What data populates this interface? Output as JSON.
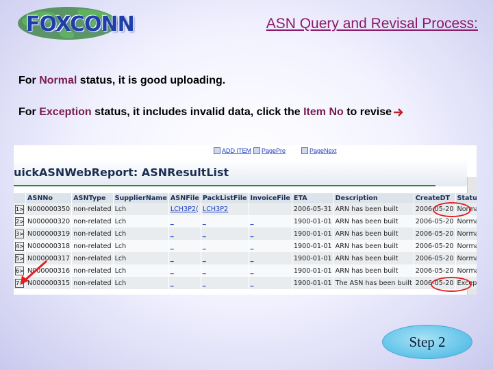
{
  "header": {
    "logo_text": "FOXCONN",
    "title": "ASN Query and Revisal Process:"
  },
  "intro": {
    "line1": {
      "prefix": "For ",
      "keyword": "Normal",
      "suffix": " status, it is good uploading."
    },
    "line2": {
      "prefix": "For ",
      "keyword": "Exception",
      "middle": " status, it includes invalid data, click the ",
      "link_word": "Item No",
      "suffix": " to revise"
    }
  },
  "toolbar": {
    "add_label": "ADD ITEM",
    "prev_label": "PagePre",
    "next_label": "PageNext"
  },
  "report": {
    "title": "uickASNWebReport: ASNResultList",
    "columns": [
      "",
      "ASNNo",
      "ASNType",
      "SupplierName",
      "ASNFile",
      "PackListFile",
      "InvoiceFile",
      "ETA",
      "Description",
      "CreateDT",
      "Status"
    ],
    "rows": [
      {
        "btn": "1>",
        "asn_no": "N000000350",
        "type": "non-related",
        "supplier": "Lch",
        "asn_file": "LCH3P2(",
        "pack_file": "LCH3P2",
        "invoice": "",
        "eta": "2006-05-31",
        "desc": "ARN has been built",
        "created": "2006-05-20",
        "status": "Normal"
      },
      {
        "btn": "2>",
        "asn_no": "N000000320",
        "type": "non-related",
        "supplier": "Lch",
        "asn_file": "_",
        "pack_file": "_",
        "invoice": "_",
        "eta": "1900-01-01",
        "desc": "ARN has been built",
        "created": "2006-05-20",
        "status": "Normal"
      },
      {
        "btn": "3>",
        "asn_no": "N000000319",
        "type": "non-related",
        "supplier": "Lch",
        "asn_file": "_",
        "pack_file": "_",
        "invoice": "_",
        "eta": "1900-01-01",
        "desc": "ARN has been built",
        "created": "2006-05-20",
        "status": "Normal"
      },
      {
        "btn": "4>",
        "asn_no": "N000000318",
        "type": "non-related",
        "supplier": "Lch",
        "asn_file": "_",
        "pack_file": "_",
        "invoice": "_",
        "eta": "1900-01-01",
        "desc": "ARN has been built",
        "created": "2006-05-20",
        "status": "Normal"
      },
      {
        "btn": "5>",
        "asn_no": "N000000317",
        "type": "non-related",
        "supplier": "Lch",
        "asn_file": "_",
        "pack_file": "_",
        "invoice": "_",
        "eta": "1900-01-01",
        "desc": "ARN has been built",
        "created": "2006-05-20",
        "status": "Normal"
      },
      {
        "btn": "6>",
        "asn_no": "N000000316",
        "type": "non-related",
        "supplier": "Lch",
        "asn_file": "_",
        "pack_file": "_",
        "invoice": "_",
        "eta": "1900-01-01",
        "desc": "ARN has been built",
        "created": "2006-05-20",
        "status": "Normal"
      },
      {
        "btn": "7>",
        "asn_no": "N000000315",
        "type": "non-related",
        "supplier": "Lch",
        "asn_file": "_",
        "pack_file": "_",
        "invoice": "_",
        "eta": "1900-01-01",
        "desc": "The ASN has been built",
        "created": "2006-05-20",
        "status": "Exception"
      }
    ]
  },
  "step_label": "Step 2",
  "colors": {
    "title": "#8b1a6a",
    "keyword": "#7a1b4f",
    "highlight_ring": "#e02020",
    "step_badge": "#68c6ea"
  }
}
